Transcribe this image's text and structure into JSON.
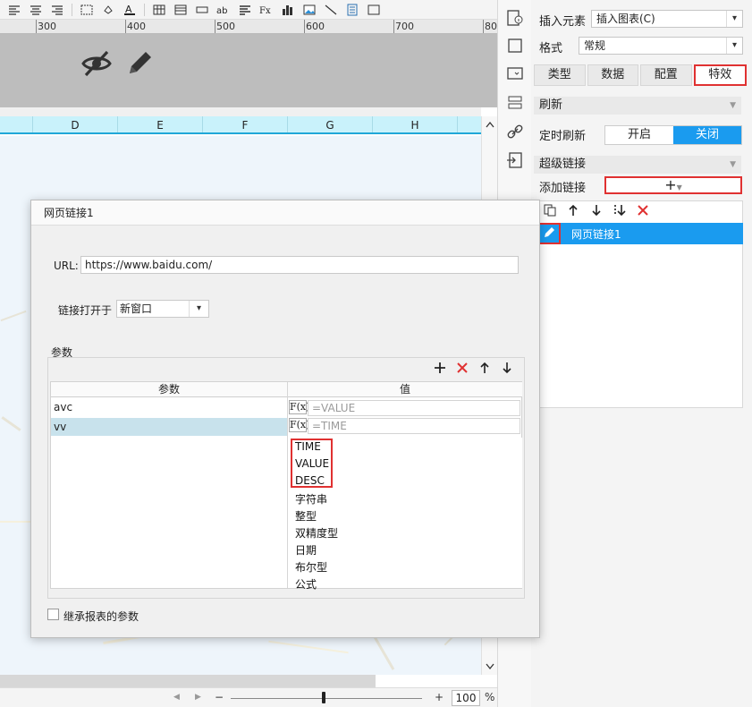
{
  "ruler": {
    "labels": [
      "300",
      "400",
      "500",
      "600",
      "700",
      "80"
    ]
  },
  "sheet": {
    "columns": [
      "D",
      "E",
      "F",
      "G",
      "H"
    ]
  },
  "zoom": {
    "value": "100",
    "unit": "%",
    "minus": "−",
    "plus": "+"
  },
  "panel": {
    "insert_label": "插入元素",
    "insert_value": "插入图表(C)",
    "format_label": "格式",
    "format_value": "常规",
    "tabs": [
      "类型",
      "数据",
      "配置",
      "特效"
    ],
    "active_tab": "特效",
    "refresh_section": "刷新",
    "timed_refresh_label": "定时刷新",
    "toggle_on": "开启",
    "toggle_off": "关闭",
    "hyperlink_section": "超级链接",
    "add_link_label": "添加链接",
    "add_link_symbol": "+",
    "link_items": [
      "网页链接1"
    ]
  },
  "dialog": {
    "title": "网页链接1",
    "url_label": "URL:",
    "url_value": "https://www.baidu.com/",
    "open_label": "链接打开于",
    "open_value": "新窗口",
    "params_label": "参数",
    "table_headers": [
      "参数",
      "值"
    ],
    "rows": [
      {
        "param": "avc",
        "value_placeholder": "=VALUE"
      },
      {
        "param": "vv",
        "value_placeholder": "=TIME"
      }
    ],
    "dropdown_options": [
      "TIME",
      "VALUE",
      "DESC",
      "字符串",
      "整型",
      "双精度型",
      "日期",
      "布尔型",
      "公式"
    ],
    "inherit_label": "继承报表的参数"
  },
  "colors": {
    "accent": "#1a9bef",
    "highlight_border": "#e03131",
    "column_header": "#c9f2fb"
  }
}
